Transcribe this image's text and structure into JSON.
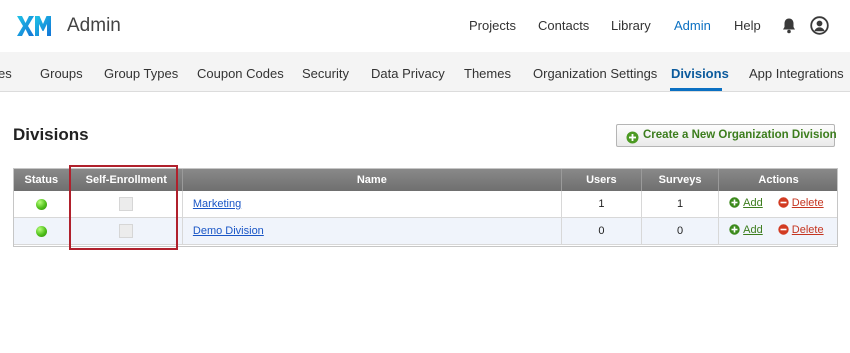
{
  "header": {
    "app_title": "Admin",
    "nav": [
      "Projects",
      "Contacts",
      "Library",
      "Admin",
      "Help"
    ],
    "active_nav": "Admin",
    "brand_color": "#0b70c2"
  },
  "subnav": {
    "items": [
      "es",
      "Groups",
      "Group Types",
      "Coupon Codes",
      "Security",
      "Data Privacy",
      "Themes",
      "Organization Settings",
      "Divisions",
      "App Integrations"
    ],
    "active": "Divisions"
  },
  "page": {
    "title": "Divisions",
    "create_button": "Create a New Organization Division"
  },
  "table": {
    "headers": [
      "Status",
      "Self-Enrollment",
      "Name",
      "Users",
      "Surveys",
      "Actions"
    ],
    "rows": [
      {
        "name": "Marketing",
        "users": "1",
        "surveys": "1",
        "add": "Add",
        "delete": "Delete"
      },
      {
        "name": "Demo Division",
        "users": "0",
        "surveys": "0",
        "add": "Add",
        "delete": "Delete"
      }
    ]
  },
  "icons": [
    "xm-logo-icon",
    "bell-icon",
    "user-icon",
    "plus-circle-icon",
    "status-green-icon",
    "add-circle-icon",
    "delete-circle-icon"
  ],
  "colors": {
    "add_green": "#3c7d1d",
    "delete_red": "#c53520",
    "highlight_red": "#b0202c",
    "link_blue": "#1a56c6"
  }
}
